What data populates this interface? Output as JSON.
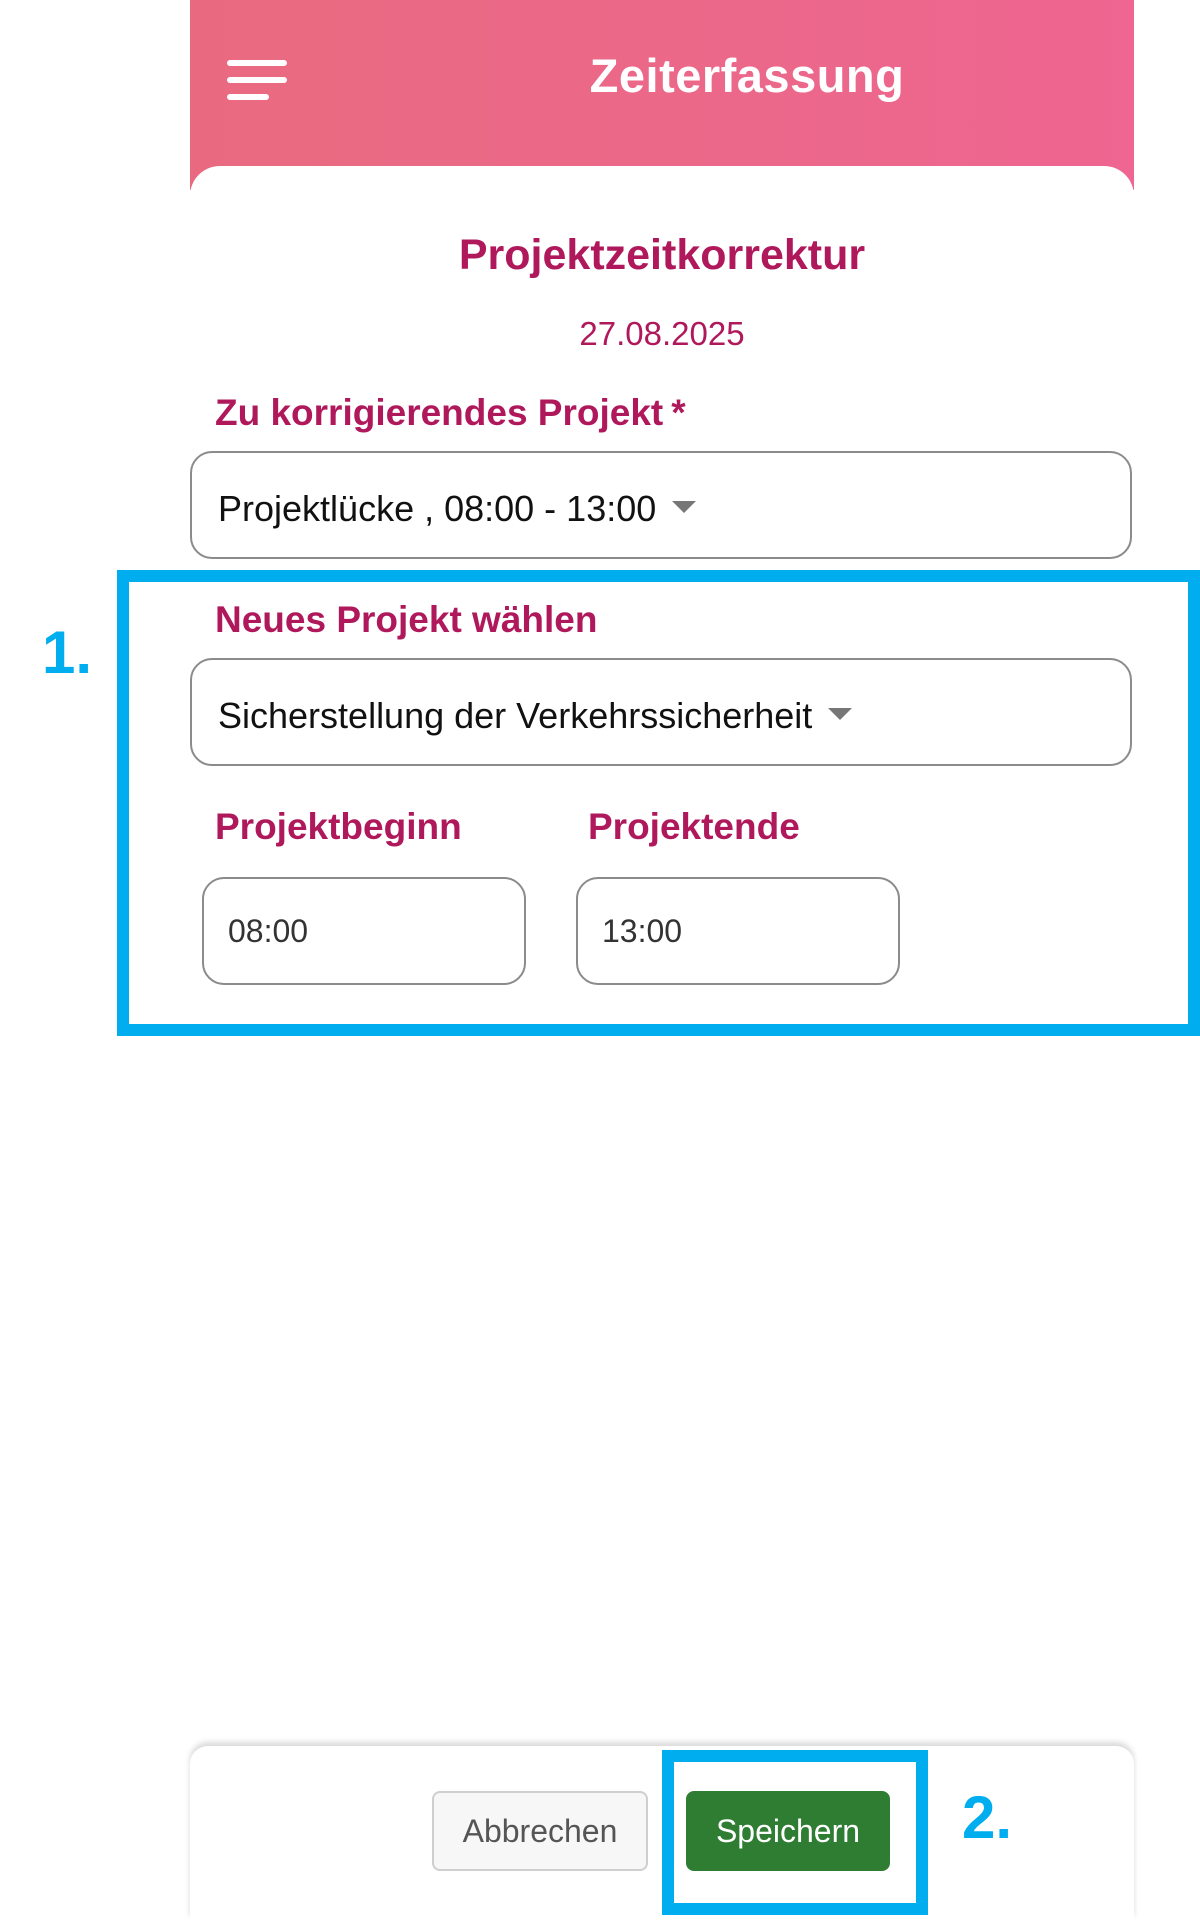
{
  "header": {
    "menu_icon": "hamburger-menu-icon",
    "title": "Zeiterfassung"
  },
  "page": {
    "title": "Projektzeitkorrektur",
    "date": "27.08.2025"
  },
  "form": {
    "project_to_correct": {
      "label": "Zu korrigierendes Projekt",
      "required_marker": "*",
      "selected": "Projektlücke , 08:00 - 13:00"
    },
    "new_project": {
      "label": "Neues Projekt wählen",
      "selected": "Sicherstellung der Verkehrssicherheit"
    },
    "project_start": {
      "label": "Projektbeginn",
      "value": "08:00"
    },
    "project_end": {
      "label": "Projektende",
      "value": "13:00"
    }
  },
  "footer": {
    "cancel_label": "Abbrechen",
    "save_label": "Speichern"
  },
  "annotations": {
    "step1": "1.",
    "step2": "2.",
    "color": "#00aeef"
  },
  "colors": {
    "header_gradient_start": "#e96a80",
    "header_gradient_end": "#ee6691",
    "accent_text": "#b0185c",
    "save_button": "#2e7d32"
  }
}
